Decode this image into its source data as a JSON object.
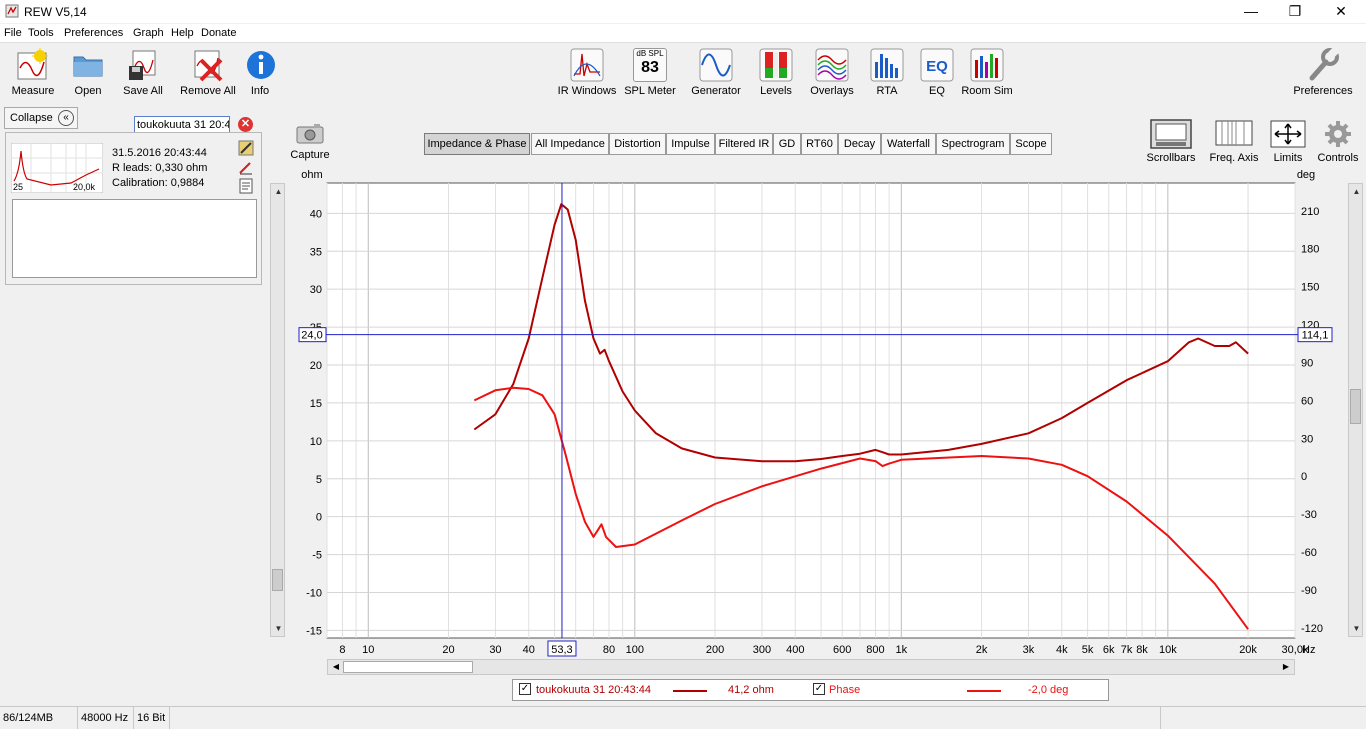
{
  "window": {
    "title": "REW V5,14",
    "minimize": "—",
    "maximize": "❐",
    "close": "✕"
  },
  "menu": [
    "File",
    "Tools",
    "Preferences",
    "Graph",
    "Help",
    "Donate"
  ],
  "toolbar_left": [
    {
      "label": "Measure",
      "icon": "measure-icon"
    },
    {
      "label": "Open",
      "icon": "folder-icon"
    },
    {
      "label": "Save All",
      "icon": "save-icon"
    },
    {
      "label": "Remove All",
      "icon": "remove-icon"
    },
    {
      "label": "Info",
      "icon": "info-icon"
    }
  ],
  "toolbar_center": [
    {
      "label": "IR Windows",
      "icon": "ir-windows-icon"
    },
    {
      "label": "SPL Meter",
      "icon": "spl-meter-icon",
      "display_top": "dB SPL",
      "display_value": "83"
    },
    {
      "label": "Generator",
      "icon": "generator-icon"
    },
    {
      "label": "Levels",
      "icon": "levels-icon"
    },
    {
      "label": "Overlays",
      "icon": "overlays-icon"
    },
    {
      "label": "RTA",
      "icon": "rta-icon"
    },
    {
      "label": "EQ",
      "icon": "eq-icon"
    },
    {
      "label": "Room Sim",
      "icon": "room-sim-icon"
    }
  ],
  "preferences_label": "Preferences",
  "panel": {
    "collapse_label": "Collapse",
    "measurement_name": "toukokuuta 31 20:43:44",
    "date": "31.5.2016 20:43:44",
    "r_leads": "R leads: 0,330 ohm",
    "calibration": "Calibration: 0,9884",
    "thumb_left": "25",
    "thumb_right": "20,0k"
  },
  "capture": {
    "label": "Capture"
  },
  "tabs": [
    "Impedance & Phase",
    "All Impedance",
    "Distortion",
    "Impulse",
    "Filtered IR",
    "GD",
    "RT60",
    "Decay",
    "Waterfall",
    "Spectrogram",
    "Scope"
  ],
  "active_tab": "Impedance & Phase",
  "right_tools": [
    {
      "label": "Scrollbars",
      "icon": "scrollbars-icon"
    },
    {
      "label": "Freq. Axis",
      "icon": "freq-axis-icon"
    },
    {
      "label": "Limits",
      "icon": "limits-icon"
    },
    {
      "label": "Controls",
      "icon": "gear-icon"
    }
  ],
  "chart_data": {
    "type": "line",
    "left_unit": "ohm",
    "right_unit": "deg",
    "x_unit": "Hz",
    "x_scale": "log",
    "xlim": [
      7,
      30000
    ],
    "ylim_left": [
      -16,
      44
    ],
    "ylim_right": [
      -128,
      232
    ],
    "y_left_ticks": [
      "40",
      "35",
      "30",
      "25",
      "20",
      "15",
      "10",
      "5",
      "0",
      "-5",
      "-10",
      "-15"
    ],
    "y_right_ticks": [
      "210",
      "180",
      "150",
      "120",
      "90",
      "60",
      "30",
      "0",
      "-30",
      "-60",
      "-90",
      "-120"
    ],
    "x_ticks": [
      "8",
      "10",
      "20",
      "30",
      "40",
      "80",
      "100",
      "200",
      "300",
      "400",
      "600",
      "800",
      "1k",
      "2k",
      "3k",
      "4k",
      "5k",
      "6k",
      "7k",
      "8k",
      "10k",
      "20k",
      "30,0k"
    ],
    "cursor": {
      "x_readout": "53,3",
      "y_left_readout": "24,0",
      "y_right_readout": "114,1"
    },
    "grid": true,
    "series": [
      {
        "name": "toukokuuta 31 20:43:44",
        "color": "#b00000",
        "axis": "left",
        "points": [
          [
            25,
            11.5
          ],
          [
            30,
            13.5
          ],
          [
            35,
            17.5
          ],
          [
            40,
            23.5
          ],
          [
            45,
            31.5
          ],
          [
            50,
            38.5
          ],
          [
            53,
            41.2
          ],
          [
            56,
            40.5
          ],
          [
            60,
            36.5
          ],
          [
            65,
            28.5
          ],
          [
            70,
            23.5
          ],
          [
            74,
            21.5
          ],
          [
            77,
            22
          ],
          [
            80,
            20.5
          ],
          [
            90,
            16.5
          ],
          [
            100,
            14
          ],
          [
            120,
            11
          ],
          [
            150,
            9
          ],
          [
            200,
            7.8
          ],
          [
            300,
            7.3
          ],
          [
            400,
            7.3
          ],
          [
            500,
            7.6
          ],
          [
            600,
            8
          ],
          [
            700,
            8.3
          ],
          [
            800,
            8.8
          ],
          [
            850,
            8.5
          ],
          [
            900,
            8.2
          ],
          [
            1000,
            8.2
          ],
          [
            1500,
            8.8
          ],
          [
            2000,
            9.6
          ],
          [
            3000,
            11
          ],
          [
            4000,
            13
          ],
          [
            5000,
            15
          ],
          [
            7000,
            18
          ],
          [
            10000,
            20.5
          ],
          [
            12000,
            23
          ],
          [
            13000,
            23.5
          ],
          [
            15000,
            22.5
          ],
          [
            17000,
            22.5
          ],
          [
            18000,
            23
          ],
          [
            20000,
            21.5
          ]
        ]
      },
      {
        "name": "Phase",
        "color": "#ee1111",
        "axis": "right",
        "points": [
          [
            25,
            60
          ],
          [
            30,
            68
          ],
          [
            35,
            70
          ],
          [
            40,
            69
          ],
          [
            45,
            64
          ],
          [
            50,
            49
          ],
          [
            55,
            17
          ],
          [
            60,
            -14
          ],
          [
            65,
            -36
          ],
          [
            70,
            -48
          ],
          [
            75,
            -38
          ],
          [
            78,
            -48
          ],
          [
            85,
            -56
          ],
          [
            100,
            -54
          ],
          [
            150,
            -35
          ],
          [
            200,
            -22
          ],
          [
            300,
            -8
          ],
          [
            500,
            6
          ],
          [
            700,
            14
          ],
          [
            800,
            12
          ],
          [
            850,
            8
          ],
          [
            900,
            10
          ],
          [
            1000,
            13
          ],
          [
            2000,
            16
          ],
          [
            3000,
            14
          ],
          [
            4000,
            9
          ],
          [
            5000,
            0
          ],
          [
            7000,
            -20
          ],
          [
            10000,
            -47
          ],
          [
            15000,
            -85
          ],
          [
            20000,
            -121
          ]
        ]
      }
    ]
  },
  "legend": {
    "series1_name": "toukokuuta 31 20:43:44",
    "series1_value": "41,2 ohm",
    "series2_name": "Phase",
    "series2_value": "-2,0 deg"
  },
  "status": {
    "memory": "86/124MB",
    "rate": "48000 Hz",
    "bits": "16 Bit"
  }
}
